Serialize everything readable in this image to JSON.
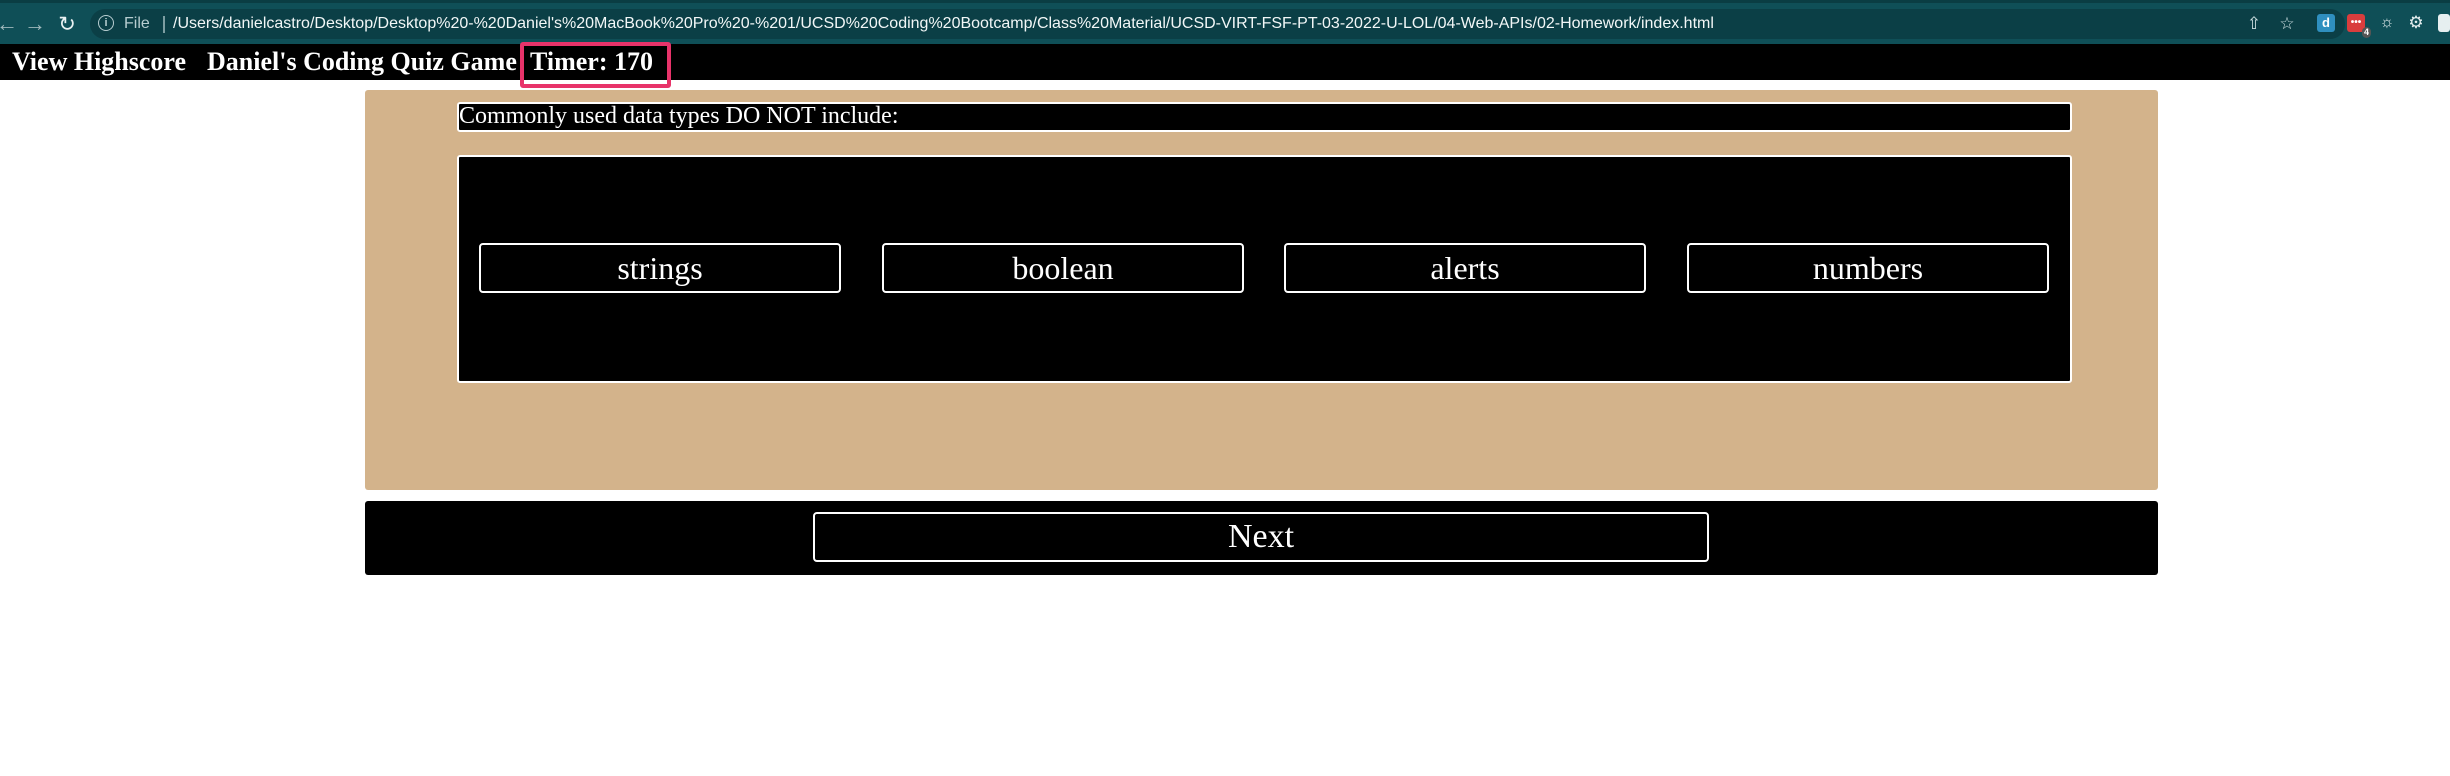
{
  "browser": {
    "file_label": "File",
    "url": "/Users/danielcastro/Desktop/Desktop%20-%20Daniel's%20MacBook%20Pro%20-%201/UCSD%20Coding%20Bootcamp/Class%20Material/UCSD-VIRT-FSF-PT-03-2022-U-LOL/04-Web-APIs/02-Homework/index.html",
    "icons": [
      "back-icon",
      "forward-icon",
      "reload-icon",
      "info-icon",
      "share-icon",
      "bookmark-star-icon",
      "extension-d-icon",
      "extension-badge-icon",
      "extension-circle-icon",
      "extension-gear-icon"
    ],
    "ext_d_label": "d",
    "ext_badge_label": "4"
  },
  "header": {
    "highscore_link": "View Highscore",
    "title": "Daniel's Coding Quiz Game",
    "timer": "Timer: 170"
  },
  "quiz": {
    "question": "Commonly used data types DO NOT include:",
    "answers": [
      "strings",
      "boolean",
      "alerts",
      "numbers"
    ],
    "next_label": "Next"
  },
  "colors": {
    "browser_chrome": "#0f4f57",
    "header_bg": "#000000",
    "panel_bg": "#d3b38b",
    "highlight": "#e8336a"
  }
}
